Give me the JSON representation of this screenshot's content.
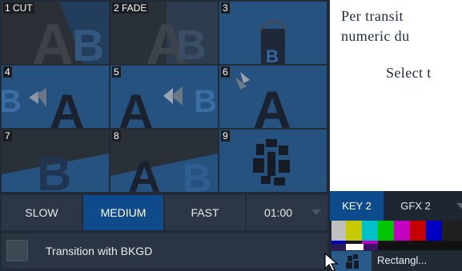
{
  "transitions": [
    {
      "label": "1 CUT"
    },
    {
      "label": "2 FADE"
    },
    {
      "label": "3"
    },
    {
      "label": "4"
    },
    {
      "label": "5"
    },
    {
      "label": "6"
    },
    {
      "label": "7"
    },
    {
      "label": "8"
    },
    {
      "label": "9",
      "selected": true
    }
  ],
  "speed": {
    "slow": "SLOW",
    "medium": "MEDIUM",
    "fast": "FAST",
    "active": "MEDIUM",
    "duration": "01:00"
  },
  "bkgd": {
    "label": "Transition with BKGD",
    "checked": false
  },
  "doc": {
    "line1": "Per transit",
    "line2": "numeric du",
    "line3": "Select t"
  },
  "key_panel": {
    "tabs": [
      "KEY 2",
      "GFX 2"
    ],
    "active_tab": "KEY 2",
    "source_name": "Rectangl..."
  },
  "colors": {
    "accent": "#0f4a8a",
    "cell_blue": "#26527f",
    "panel_bg": "#212b38"
  }
}
